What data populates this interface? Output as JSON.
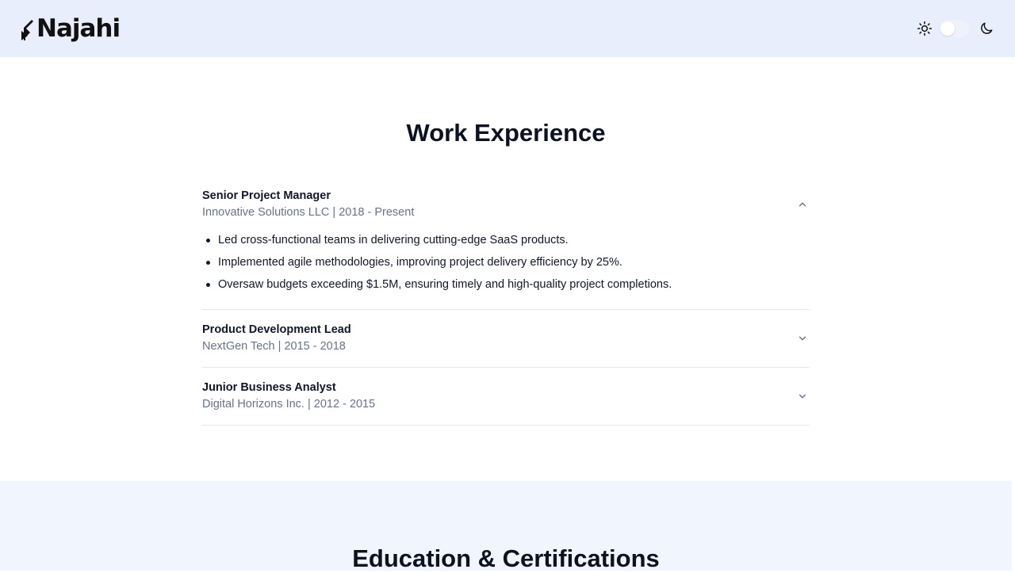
{
  "header": {
    "logo_text": "Najahi",
    "theme_toggle": {
      "light_icon": "sun-icon",
      "dark_icon": "moon-icon",
      "mode": "light"
    }
  },
  "work": {
    "title": "Work Experience",
    "items": [
      {
        "role": "Senior Project Manager",
        "meta": "Innovative Solutions LLC | 2018 - Present",
        "expanded": true,
        "bullets": [
          "Led cross-functional teams in delivering cutting-edge SaaS products.",
          "Implemented agile methodologies, improving project delivery efficiency by 25%.",
          "Oversaw budgets exceeding $1.5M, ensuring timely and high-quality project completions."
        ]
      },
      {
        "role": "Product Development Lead",
        "meta": "NextGen Tech | 2015 - 2018",
        "expanded": false
      },
      {
        "role": "Junior Business Analyst",
        "meta": "Digital Horizons Inc. | 2012 - 2015",
        "expanded": false
      }
    ]
  },
  "education": {
    "title": "Education & Certifications"
  },
  "colors": {
    "header_bg": "#e8eefb",
    "text_dark": "#0f172a",
    "text_muted": "#64748b",
    "divider": "#e5e7eb",
    "section_alt_bg": "#f1f5fe"
  }
}
